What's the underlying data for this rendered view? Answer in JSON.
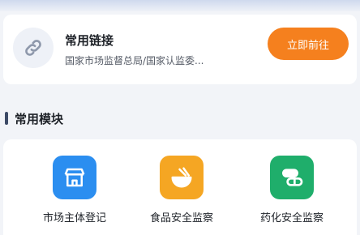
{
  "link_card": {
    "title": "常用链接",
    "subtitle": "国家市场监督总局/国家认监委...",
    "button_label": "立即前往",
    "icon": "link-icon"
  },
  "section": {
    "title": "常用模块"
  },
  "modules": [
    {
      "label": "市场主体登记",
      "icon": "store-icon",
      "color": "#2b8ef0"
    },
    {
      "label": "食品安全监察",
      "icon": "food-bowl-icon",
      "color": "#f5a623"
    },
    {
      "label": "药化安全监察",
      "icon": "pills-icon",
      "color": "#1fae6b"
    }
  ],
  "colors": {
    "accent": "#f5801e"
  }
}
